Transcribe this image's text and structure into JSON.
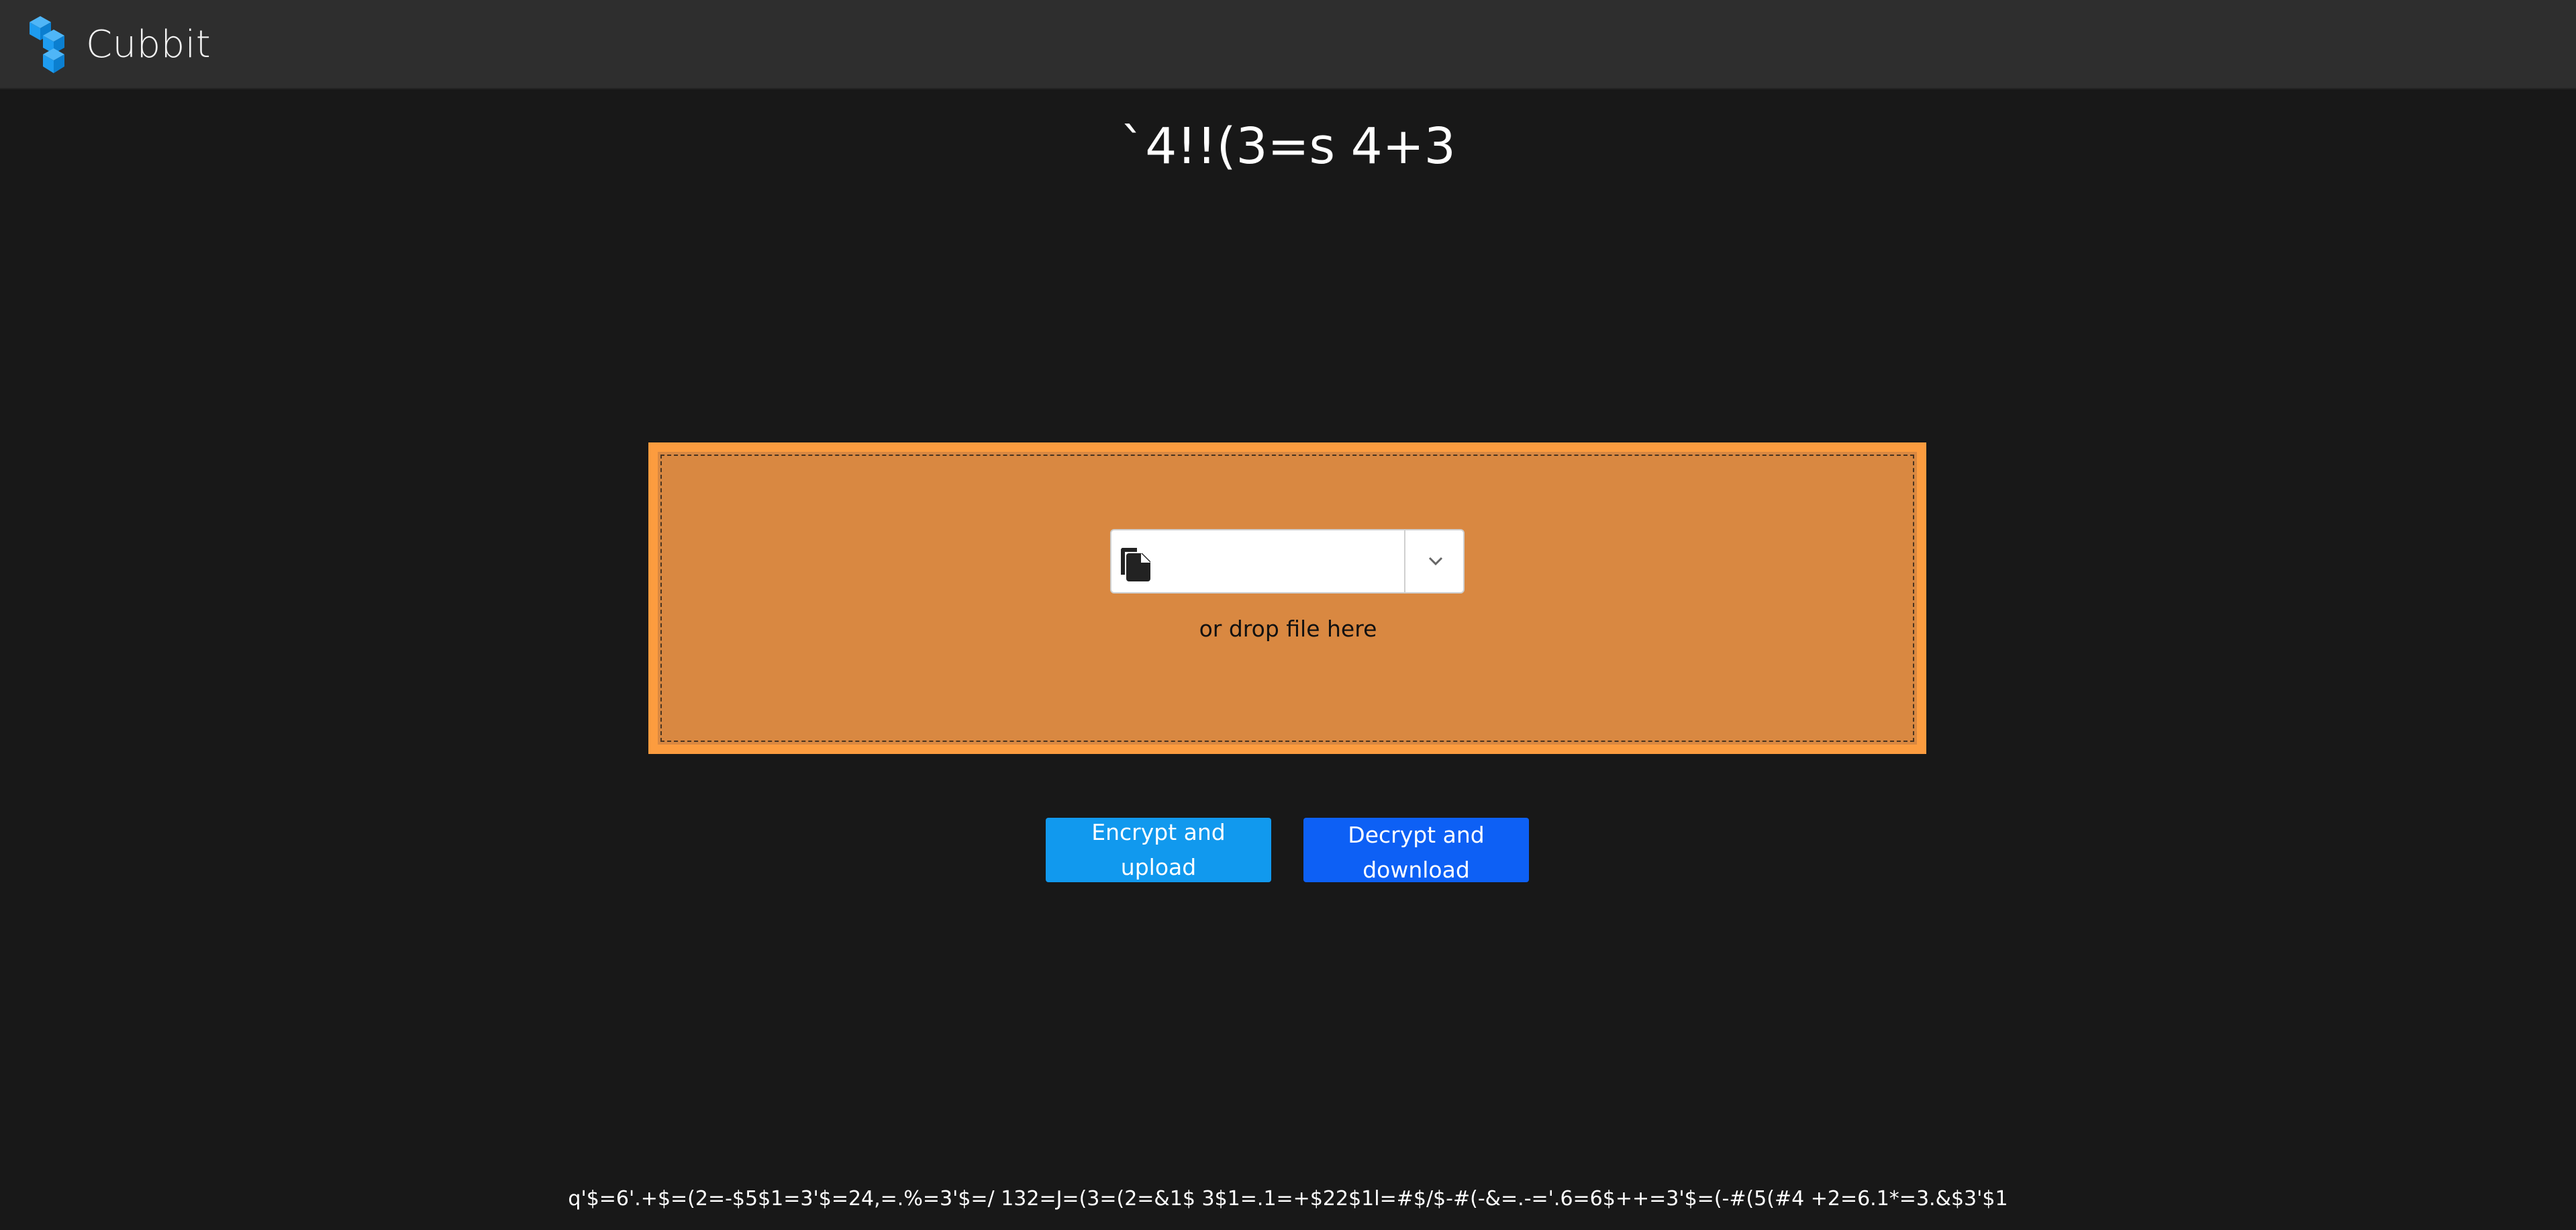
{
  "navbar": {
    "brand_name": "Cubbit",
    "logo_icon": "cubbit-cubes-logo-icon",
    "logo_color": "#1e9cf0",
    "background": "#2e2e2e"
  },
  "page": {
    "title": "`4!!(3=s 4+3",
    "background": "#181818"
  },
  "dropzone": {
    "background": "#d98841",
    "border_color": "#fc9c3f",
    "file_select": {
      "icon": "file-copy-icon",
      "value": "",
      "dropdown_icon": "chevron-down-icon"
    },
    "hint": "or drop file here"
  },
  "actions": {
    "encrypt_label": "Encrypt and upload",
    "encrypt_color": "#1199ee",
    "decrypt_label": "Decrypt and download",
    "decrypt_color": "#0d60f5"
  },
  "footer": {
    "text": "q'$=6'.+$=(2=-$5$1=3'$=24,=.%=3'$=/ 132=J=(3=(2=&1$ 3$1=.1=+$22$1l=#$/$-#(-&=.-='.6=6$++=3'$=(-#(5(#4 +2=6.1*=3.&$3'$1"
  }
}
